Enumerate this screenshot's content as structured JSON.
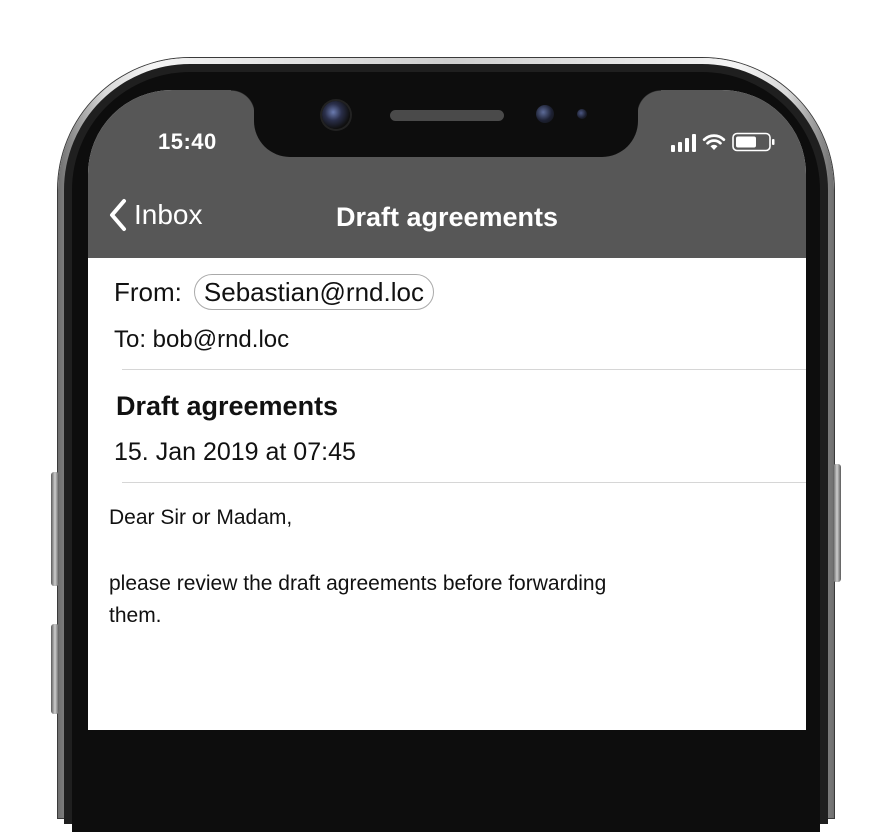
{
  "status_bar": {
    "time": "15:40"
  },
  "nav": {
    "back_label": "Inbox",
    "title": "Draft agreements"
  },
  "message": {
    "from_label": "From:",
    "from_address": "Sebastian@rnd.loc",
    "to_line": "To: bob@rnd.loc",
    "subject": "Draft agreements",
    "date": "15. Jan 2019 at 07:45",
    "body": {
      "greeting": "Dear Sir or Madam,",
      "paragraph": "please review the draft agreements before forwarding them."
    }
  },
  "icons": {
    "back": "chevron-left-icon",
    "signal": "cellular-signal-icon",
    "wifi": "wifi-icon",
    "battery": "battery-icon"
  },
  "colors": {
    "topbar": "#575757",
    "background": "#ffffff",
    "text": "#111111"
  }
}
